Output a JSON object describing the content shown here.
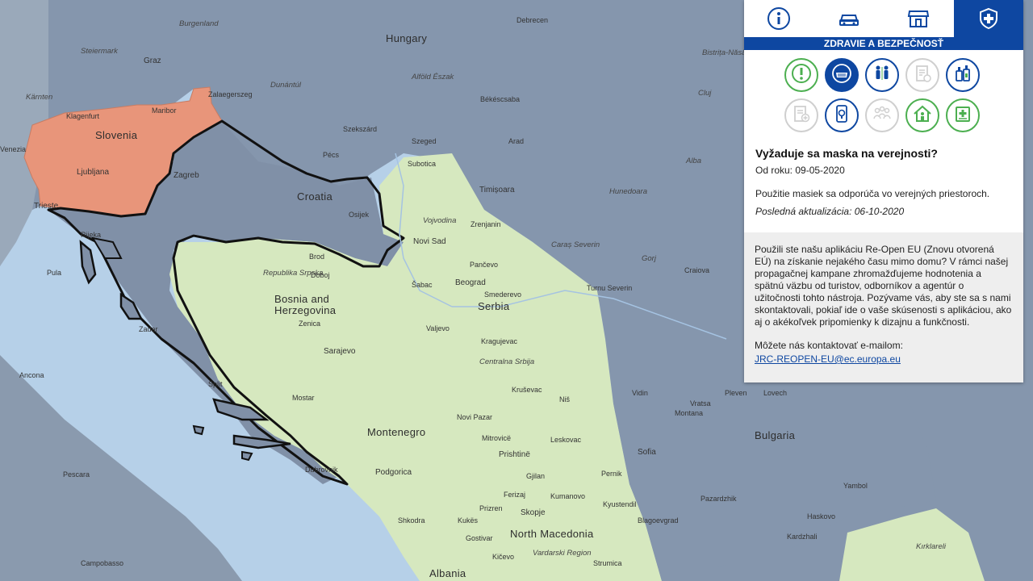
{
  "map": {
    "countries": {
      "hungary": "Hungary",
      "slovenia": "Slovenia",
      "croatia": "Croatia",
      "bosnia": "Bosnia and\nHerzegovina",
      "serbia": "Serbia",
      "montenegro": "Montenegro",
      "bulgaria": "Bulgaria",
      "north_macedonia": "North Macedonia",
      "albania": "Albania",
      "kosovo": "Prishtinë"
    },
    "cities": [
      {
        "name": "Graz"
      },
      {
        "name": "Burgenland"
      },
      {
        "name": "Steiermark"
      },
      {
        "name": "Kärnten"
      },
      {
        "name": "Klagenfurt"
      },
      {
        "name": "Maribor"
      },
      {
        "name": "Ljubljana"
      },
      {
        "name": "Venezia"
      },
      {
        "name": "Trieste"
      },
      {
        "name": "Rijeka"
      },
      {
        "name": "Pula"
      },
      {
        "name": "Zagreb"
      },
      {
        "name": "Zalaegerszeg"
      },
      {
        "name": "Dunántúl"
      },
      {
        "name": "Szekszárd"
      },
      {
        "name": "Pécs"
      },
      {
        "name": "Osijek"
      },
      {
        "name": "Szeged"
      },
      {
        "name": "Alföld Észak"
      },
      {
        "name": "Debrecen"
      },
      {
        "name": "Békéscsaba"
      },
      {
        "name": "Arad"
      },
      {
        "name": "Timișoara"
      },
      {
        "name": "Subotica"
      },
      {
        "name": "Vojvodina"
      },
      {
        "name": "Novi Sad"
      },
      {
        "name": "Zrenjanin"
      },
      {
        "name": "Pančevo"
      },
      {
        "name": "Beograd"
      },
      {
        "name": "Smederevo"
      },
      {
        "name": "Šabac"
      },
      {
        "name": "Valjevo"
      },
      {
        "name": "Kragujevac"
      },
      {
        "name": "Centralna Srbija"
      },
      {
        "name": "Kruševac"
      },
      {
        "name": "Niš"
      },
      {
        "name": "Novi Pazar"
      },
      {
        "name": "Mitrovicë"
      },
      {
        "name": "Leskovac"
      },
      {
        "name": "Ferizaj"
      },
      {
        "name": "Prizren"
      },
      {
        "name": "Gjilan"
      },
      {
        "name": "Skopje"
      },
      {
        "name": "Kumanovo"
      },
      {
        "name": "Shkodra"
      },
      {
        "name": "Podgorica"
      },
      {
        "name": "Kukës"
      },
      {
        "name": "Gostivar"
      },
      {
        "name": "Kičevo"
      },
      {
        "name": "Strumica"
      },
      {
        "name": "Vardarski Region"
      },
      {
        "name": "Republika Srpska"
      },
      {
        "name": "Brod"
      },
      {
        "name": "Doboj"
      },
      {
        "name": "Zenica"
      },
      {
        "name": "Sarajevo"
      },
      {
        "name": "Mostar"
      },
      {
        "name": "Split"
      },
      {
        "name": "Zadar"
      },
      {
        "name": "Dubrovnik"
      },
      {
        "name": "Ancona"
      },
      {
        "name": "Pescara"
      },
      {
        "name": "Campobasso"
      },
      {
        "name": "Craiova"
      },
      {
        "name": "Caraș Severin"
      },
      {
        "name": "Gorj"
      },
      {
        "name": "Turnu Severin"
      },
      {
        "name": "Hunedoara"
      },
      {
        "name": "Alba"
      },
      {
        "name": "Cluj"
      },
      {
        "name": "Bistrița-Năsăud"
      },
      {
        "name": "Vidin"
      },
      {
        "name": "Montana"
      },
      {
        "name": "Vratsa"
      },
      {
        "name": "Pleven"
      },
      {
        "name": "Lovech"
      },
      {
        "name": "Sofia"
      },
      {
        "name": "Pernik"
      },
      {
        "name": "Kyustendil"
      },
      {
        "name": "Blagoevgrad"
      },
      {
        "name": "Yambol"
      },
      {
        "name": "Kardzhali"
      },
      {
        "name": "Haskovo"
      },
      {
        "name": "Pazardzhik"
      },
      {
        "name": "Kırklareli"
      }
    ]
  },
  "panel": {
    "tabs": [
      {
        "name": "info",
        "label": "info-icon"
      },
      {
        "name": "transport",
        "label": "car-icon"
      },
      {
        "name": "shops",
        "label": "store-icon"
      },
      {
        "name": "health",
        "label": "shield-cross-icon"
      }
    ],
    "section_title": "ZDRAVIE A BEZPEČNOSŤ",
    "info": {
      "title": "Vyžaduje sa maska na verejnosti?",
      "since": "Od roku: 09-05-2020",
      "description": "Použitie masiek sa odporúča vo verejných priestoroch.",
      "updated": "Posledná aktualizácia: 06-10-2020"
    },
    "feedback": {
      "text": "Použili ste našu aplikáciu Re-Open EU (Znovu otvorená EÚ) na získanie nejakého času mimo domu? V rámci našej propagačnej kampane zhromažďujeme hodnotenia a spätnú väzbu od turistov, odborníkov a agentúr o užitočnosti tohto nástroja. Pozývame vás, aby ste sa s nami skontaktovali, pokiaľ ide o vaše skúsenosti s aplikáciou, ako aj o akékoľvek pripomienky k dizajnu a funkčnosti.",
      "contact_label": "Môžete nás kontaktovať e-mailom:",
      "email": "JRC-REOPEN-EU@ec.europa.eu"
    }
  },
  "colors": {
    "sea": "#b6d0e8",
    "overlay_grey": "#8596ad",
    "highlight_orange": "#e8957a",
    "open_green": "#d6e8bf",
    "brand_blue": "#0e47a1",
    "green_icon": "#4caf50"
  }
}
